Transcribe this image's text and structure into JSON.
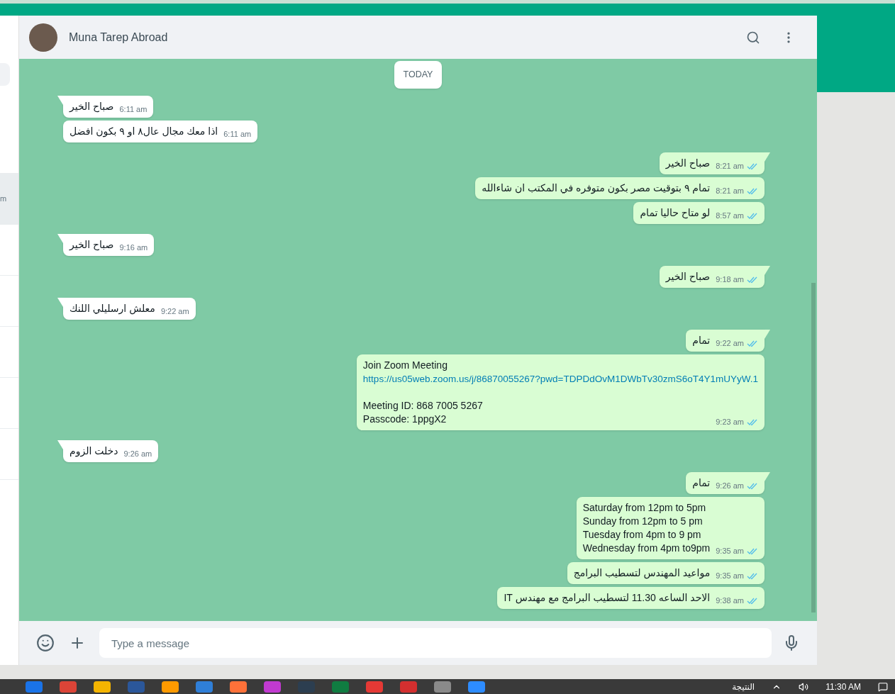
{
  "sidebar": {
    "items": [
      {
        "time": "m",
        "selected": true
      },
      {
        "selected": false
      },
      {
        "selected": false
      },
      {
        "selected": false
      },
      {
        "selected": false
      },
      {
        "selected": false
      },
      {
        "selected": false
      }
    ]
  },
  "chat": {
    "contact_name": "Muna Tarep Abroad",
    "date_label": "TODAY",
    "messages": [
      {
        "kind": "incoming",
        "group_start": true,
        "lines": [
          {
            "kind": "text",
            "text": "صباح الخير"
          }
        ],
        "time": "6:11 am"
      },
      {
        "kind": "incoming",
        "group_start": false,
        "lines": [
          {
            "kind": "text",
            "text": "اذا معك مجال عال٨ او ٩ بكون افضل"
          }
        ],
        "time": "6:11 am"
      },
      {
        "kind": "outgoing",
        "group_start": true,
        "lines": [
          {
            "kind": "text",
            "text": "صباح الخير"
          }
        ],
        "time": "8:21 am",
        "read": true
      },
      {
        "kind": "outgoing",
        "group_start": false,
        "lines": [
          {
            "kind": "text",
            "text": "تمام ٩ بتوقيت مصر بكون متوفره في المكتب ان شاءالله"
          }
        ],
        "time": "8:21 am",
        "read": true
      },
      {
        "kind": "outgoing",
        "group_start": false,
        "lines": [
          {
            "kind": "text",
            "text": "لو متاح حاليا تمام"
          }
        ],
        "time": "8:57 am",
        "read": true
      },
      {
        "kind": "incoming",
        "group_start": true,
        "lines": [
          {
            "kind": "text",
            "text": "صباح الخير"
          }
        ],
        "time": "9:16 am"
      },
      {
        "kind": "outgoing",
        "group_start": true,
        "lines": [
          {
            "kind": "text",
            "text": "صباح الخير"
          }
        ],
        "time": "9:18 am",
        "read": true
      },
      {
        "kind": "incoming",
        "group_start": true,
        "lines": [
          {
            "kind": "text",
            "text": "معلش ارسليلي اللنك"
          }
        ],
        "time": "9:22 am"
      },
      {
        "kind": "outgoing",
        "group_start": true,
        "lines": [
          {
            "kind": "text",
            "text": "تمام"
          }
        ],
        "time": "9:22 am",
        "read": true
      },
      {
        "kind": "outgoing",
        "group_start": false,
        "lines": [
          {
            "kind": "text",
            "text": "Join Zoom Meeting"
          },
          {
            "kind": "link",
            "text": "https://us05web.zoom.us/j/86870055267?pwd=TDPDdOvM1DWbTv30zmS6oT4Y1mUYyW.1"
          },
          {
            "kind": "text",
            "text": "Meeting ID: 868 7005 5267",
            "gap_before": true
          },
          {
            "kind": "text",
            "text": "Passcode: 1ppgX2"
          }
        ],
        "time": "9:23 am",
        "read": true
      },
      {
        "kind": "incoming",
        "group_start": true,
        "lines": [
          {
            "kind": "text",
            "text": "دخلت الزوم"
          }
        ],
        "time": "9:26 am"
      },
      {
        "kind": "outgoing",
        "group_start": true,
        "lines": [
          {
            "kind": "text",
            "text": "تمام"
          }
        ],
        "time": "9:26 am",
        "read": true
      },
      {
        "kind": "outgoing",
        "group_start": false,
        "lines": [
          {
            "kind": "text",
            "text": "Saturday from 12pm to 5pm"
          },
          {
            "kind": "text",
            "text": "Sunday from 12pm to 5 pm"
          },
          {
            "kind": "text",
            "text": "Tuesday from 4pm to 9 pm"
          },
          {
            "kind": "text",
            "text": "Wednesday from 4pm to9pm"
          }
        ],
        "time": "9:35 am",
        "read": true
      },
      {
        "kind": "outgoing",
        "group_start": false,
        "lines": [
          {
            "kind": "text",
            "text": "مواعيد المهندس لتسطيب البرامج"
          }
        ],
        "time": "9:35 am",
        "read": true
      },
      {
        "kind": "outgoing",
        "group_start": false,
        "lines": [
          {
            "kind": "text",
            "text": "الاحد الساعه 11.30 لتسطيب البرامج مع مهندس IT"
          }
        ],
        "time": "9:38 am",
        "read": true
      }
    ],
    "composer": {
      "placeholder": "Type a message"
    }
  },
  "taskbar": {
    "apps": [
      {
        "color": "#1a73e8"
      },
      {
        "color": "#db4437"
      },
      {
        "color": "#f4b400"
      },
      {
        "color": "#2b579a"
      },
      {
        "color": "#ff9a00"
      },
      {
        "color": "#2f7fd8"
      },
      {
        "color": "#ff7139"
      },
      {
        "color": "#c13ad0"
      },
      {
        "color": "#2c3e50"
      },
      {
        "color": "#107c41"
      },
      {
        "color": "#e53935"
      },
      {
        "color": "#d32f2f"
      },
      {
        "color": "#8a8a8a"
      },
      {
        "color": "#2d8cff"
      }
    ],
    "weather": "النتيجة",
    "time": "11:30 AM"
  }
}
